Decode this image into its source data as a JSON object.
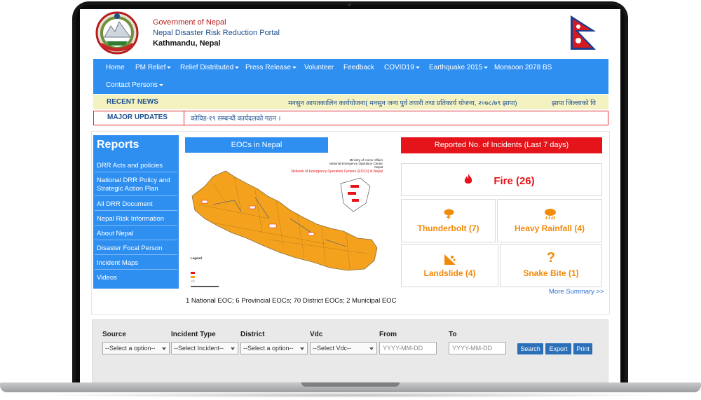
{
  "header": {
    "title": "Government of Nepal",
    "subtitle": "Nepal Disaster Risk Reduction Portal",
    "city": "Kathmandu, Nepal"
  },
  "nav": {
    "items": [
      "Home",
      "PM Relief",
      "Relief Distributed",
      "Press Release",
      "Volunteer",
      "Feedback",
      "COVID19",
      "Earthquake 2015",
      "Monsoon 2078 BS",
      "Contact Persons"
    ]
  },
  "news": {
    "label": "RECENT NEWS",
    "text": "मनसुन आपतकालिन कार्ययोजना( मनसुन जन्य पुर्व तयारी तथा प्रतिकार्य योजना, २०७८/७९ झापा)",
    "text2": "झापा जिल्लाको वि"
  },
  "updates": {
    "label": "MAJOR UPDATES",
    "text": "कोविड-१९ सम्बन्धी कार्यदलको गठन ।"
  },
  "reports": {
    "title": "Reports",
    "items": [
      "DRR Acts and policies",
      "National DRR Policy and Strategic Action Plan",
      "All DRR Document",
      "Nepal Risk Information",
      "About Nepal",
      "Disaster Focal Person",
      "Incident Maps",
      "Videos"
    ]
  },
  "eoc": {
    "title": "EOCs in Nepal",
    "map_header_1": "Ministry of Home Affairs",
    "map_header_2": "National Emergency Operation Center",
    "map_header_3": "Nepal",
    "map_title": "Network of Emergency Operation Centers (EOCs) in Nepal",
    "legend_title": "Legend",
    "caption": "1 National EOC; 6 Provincial EOCs; 70 District EOCs; 2 Municipal EOC"
  },
  "incidents": {
    "title": "Reported No. of Incidents (Last 7 days)",
    "fire": "Fire (26)",
    "thunderbolt": "Thunderbolt (7)",
    "heavy_rainfall": "Heavy Rainfall (4)",
    "landslide": "Landslide (4)",
    "snake_bite": "Snake Bite (1)",
    "more": "More Summary >>"
  },
  "search": {
    "source_label": "Source",
    "source_value": "--Select a option--",
    "incident_label": "Incident Type",
    "incident_value": "--Select Incident--",
    "district_label": "District",
    "district_value": "--Select a option--",
    "vdc_label": "Vdc",
    "vdc_value": "--Select Vdc--",
    "from_label": "From",
    "from_placeholder": "YYYY-MM-DD",
    "to_label": "To",
    "to_placeholder": "YYYY-MM-DD",
    "search_btn": "Search",
    "export_btn": "Export",
    "print_btn": "Print"
  },
  "colors": {
    "nav_blue": "#2f8ff1",
    "incident_red": "#e5141a",
    "incident_orange": "#f28a0a",
    "news_bg": "#f4f2c0"
  }
}
